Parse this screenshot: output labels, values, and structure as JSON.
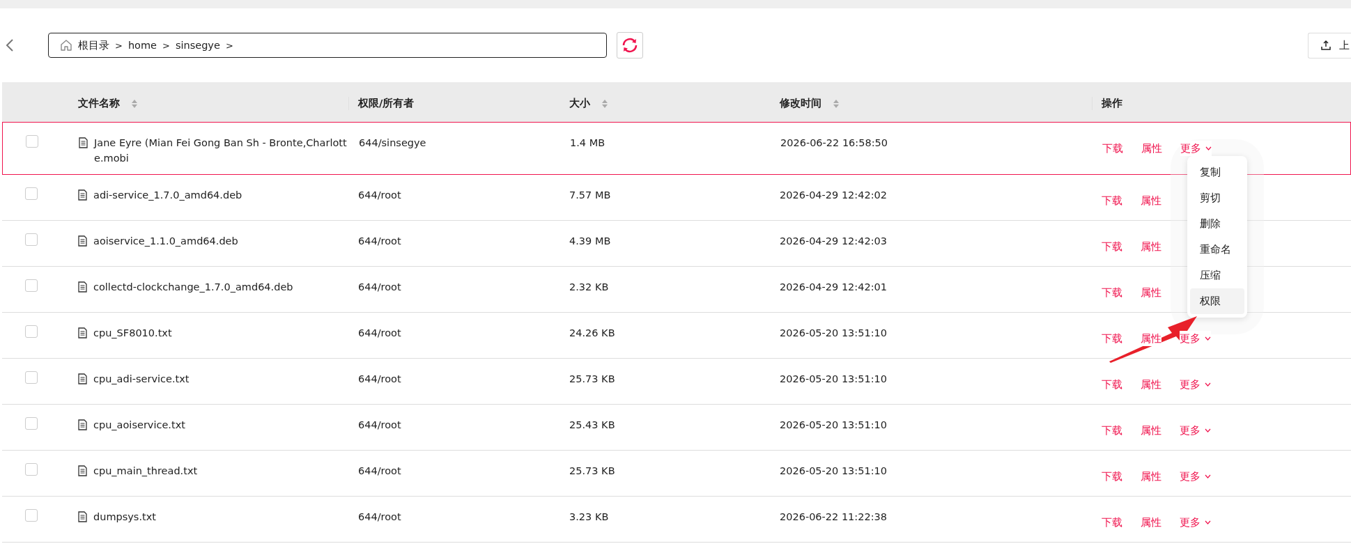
{
  "toolbar": {
    "breadcrumb": [
      {
        "label": "根目录",
        "separator": ">"
      },
      {
        "label": "home",
        "separator": ">"
      },
      {
        "label": "sinsegye",
        "separator": ">"
      }
    ],
    "upload_button": "上"
  },
  "table": {
    "columns": [
      {
        "label": "文件名称",
        "sortable": true
      },
      {
        "label": "权限/所有者",
        "sortable": false
      },
      {
        "label": "大小",
        "sortable": true
      },
      {
        "label": "修改时间",
        "sortable": true
      },
      {
        "label": "操作",
        "sortable": false
      }
    ],
    "rows": [
      {
        "name": "Jane Eyre (Mian Fei Gong Ban Sh - Bronte,Charlotte.mobi",
        "owner": "644/sinsegye",
        "size": "1.4 MB",
        "modified": "2026-06-22 16:58:50",
        "checked": false,
        "selected": true,
        "actions": [
          "下载",
          "属性"
        ],
        "more": "更多"
      },
      {
        "name": "adi-service_1.7.0_amd64.deb",
        "owner": "644/root",
        "size": "7.57 MB",
        "modified": "2026-04-29 12:42:02",
        "checked": false,
        "selected": false,
        "actions": [
          "下载",
          "属性"
        ]
      },
      {
        "name": "aoiservice_1.1.0_amd64.deb",
        "owner": "644/root",
        "size": "4.39 MB",
        "modified": "2026-04-29 12:42:03",
        "checked": false,
        "selected": false,
        "actions": [
          "下载",
          "属性"
        ]
      },
      {
        "name": "collectd-clockchange_1.7.0_amd64.deb",
        "owner": "644/root",
        "size": "2.32 KB",
        "modified": "2026-04-29 12:42:01",
        "checked": false,
        "selected": false,
        "actions": [
          "下载",
          "属性"
        ]
      },
      {
        "name": "cpu_SF8010.txt",
        "owner": "644/root",
        "size": "24.26 KB",
        "modified": "2026-05-20 13:51:10",
        "checked": false,
        "selected": false,
        "actions": [
          "下载",
          "属性"
        ],
        "more": "更多"
      },
      {
        "name": "cpu_adi-service.txt",
        "owner": "644/root",
        "size": "25.73 KB",
        "modified": "2026-05-20 13:51:10",
        "checked": false,
        "selected": false,
        "actions": [
          "下载",
          "属性"
        ],
        "more": "更多"
      },
      {
        "name": "cpu_aoiservice.txt",
        "owner": "644/root",
        "size": "25.43 KB",
        "modified": "2026-05-20 13:51:10",
        "checked": false,
        "selected": false,
        "actions": [
          "下载",
          "属性"
        ],
        "more": "更多"
      },
      {
        "name": "cpu_main_thread.txt",
        "owner": "644/root",
        "size": "25.73 KB",
        "modified": "2026-05-20 13:51:10",
        "checked": false,
        "selected": false,
        "actions": [
          "下载",
          "属性"
        ],
        "more": "更多"
      },
      {
        "name": "dumpsys.txt",
        "owner": "644/root",
        "size": "3.23 KB",
        "modified": "2026-06-22 11:22:38",
        "checked": false,
        "selected": false,
        "actions": [
          "下载",
          "属性"
        ],
        "more": "更多"
      }
    ]
  },
  "dropdown_menu": {
    "items": [
      {
        "label": "复制",
        "selected": false
      },
      {
        "label": "剪切",
        "selected": false
      },
      {
        "label": "删除",
        "selected": false
      },
      {
        "label": "重命名",
        "selected": false
      },
      {
        "label": "压缩",
        "selected": false
      },
      {
        "label": "权限",
        "selected": true
      }
    ]
  }
}
